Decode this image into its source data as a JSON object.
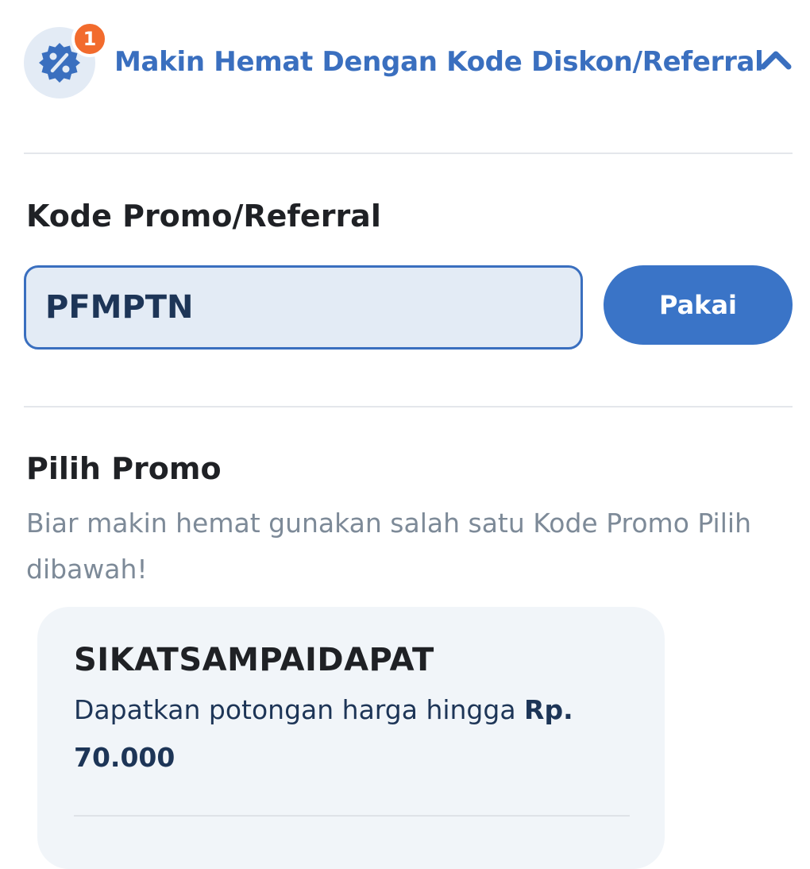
{
  "header": {
    "badge_count": "1",
    "title": "Makin Hemat Dengan Kode Diskon/Referral",
    "icon": "discount-badge-icon",
    "toggle_icon": "chevron-up-icon"
  },
  "promo_code_section": {
    "label": "Kode Promo/Referral",
    "input_value": "PFMPTN",
    "apply_label": "Pakai"
  },
  "promo_list_section": {
    "title": "Pilih Promo",
    "description": "Biar makin hemat gunakan salah satu Kode Promo Pilih dibawah!",
    "items": [
      {
        "code": "SIKATSAMPAIDAPAT",
        "description_prefix": "Dapatkan potongan harga hingga ",
        "amount": "Rp. 70.000"
      }
    ]
  },
  "colors": {
    "primary": "#3a6fbf",
    "badge": "#f26b2d",
    "input_bg": "#e3ebf5",
    "card_bg": "#f1f5f9",
    "muted_text": "#7d8a98"
  }
}
